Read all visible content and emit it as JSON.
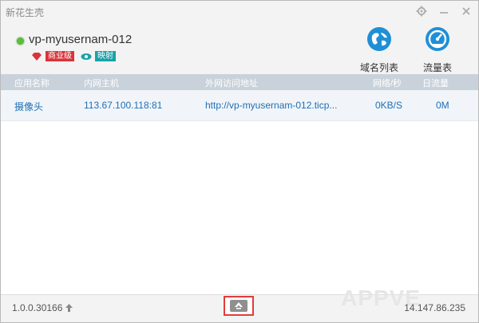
{
  "window": {
    "title": "新花生壳"
  },
  "header": {
    "hostname": "vp-myusernam-012",
    "badges": [
      {
        "label": "商业级",
        "color": "#d9343a",
        "icon": "gem-icon"
      },
      {
        "label": "映射",
        "color": "#1aa2a8",
        "icon": "eye-icon"
      }
    ],
    "status_color": "#5bbd3a",
    "tools": [
      {
        "label": "域名列表",
        "icon": "globe-icon"
      },
      {
        "label": "流量表",
        "icon": "speedometer-icon"
      }
    ]
  },
  "table": {
    "columns": [
      "应用名称",
      "内网主机",
      "外网访问地址",
      "网络/秒",
      "日流量"
    ],
    "rows": [
      {
        "name": "摄像头",
        "host": "113.67.100.118:81",
        "url": "http://vp-myusernam-012.ticp...",
        "speed": "0KB/S",
        "traffic": "0M"
      }
    ]
  },
  "footer": {
    "version": "1.0.0.30166",
    "ip": "14.147.86.235",
    "watermark": "APPVE"
  }
}
